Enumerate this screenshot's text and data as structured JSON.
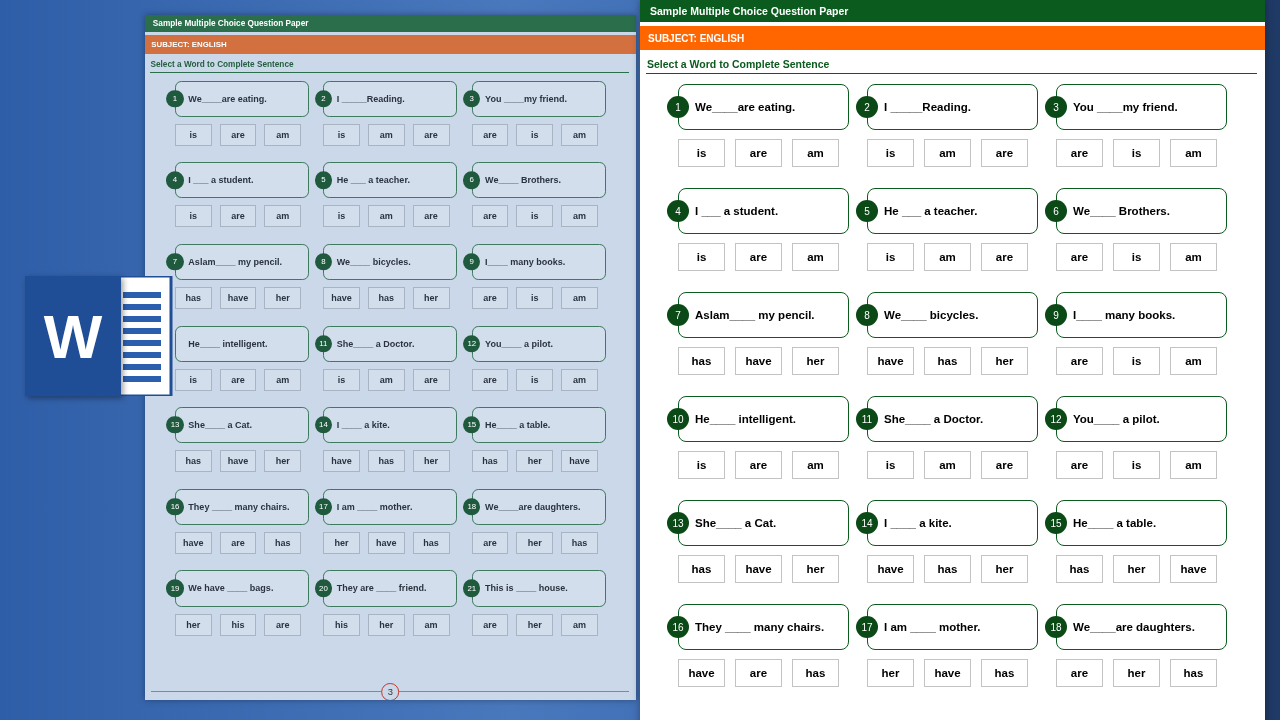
{
  "logo": {
    "letter": "W"
  },
  "back_page": {
    "title": "Sample Multiple Choice Question Paper",
    "subject": "SUBJECT: ENGLISH",
    "instruction": "Select a Word to Complete Sentence",
    "page_number": "3",
    "questions": [
      {
        "number": "1",
        "sentence": "We____are eating.",
        "options": [
          "is",
          "are",
          "am"
        ]
      },
      {
        "number": "2",
        "sentence": "I _____Reading.",
        "options": [
          "is",
          "am",
          "are"
        ]
      },
      {
        "number": "3",
        "sentence": "You ____my friend.",
        "options": [
          "are",
          "is",
          "am"
        ]
      },
      {
        "number": "4",
        "sentence": "I ___ a student.",
        "options": [
          "is",
          "are",
          "am"
        ]
      },
      {
        "number": "5",
        "sentence": "He ___ a teacher.",
        "options": [
          "is",
          "am",
          "are"
        ]
      },
      {
        "number": "6",
        "sentence": "We____ Brothers.",
        "options": [
          "are",
          "is",
          "am"
        ]
      },
      {
        "number": "7",
        "sentence": "Aslam____ my pencil.",
        "options": [
          "has",
          "have",
          "her"
        ]
      },
      {
        "number": "8",
        "sentence": "We____ bicycles.",
        "options": [
          "have",
          "has",
          "her"
        ]
      },
      {
        "number": "9",
        "sentence": "I____ many books.",
        "options": [
          "are",
          "is",
          "am"
        ]
      },
      {
        "sentence": "He____ intelligent.",
        "options": [
          "is",
          "are",
          "am"
        ]
      },
      {
        "number": "11",
        "sentence": "She____ a Doctor.",
        "options": [
          "is",
          "am",
          "are"
        ]
      },
      {
        "number": "12",
        "sentence": "You____ a pilot.",
        "options": [
          "are",
          "is",
          "am"
        ]
      },
      {
        "number": "13",
        "sentence": "She____ a Cat.",
        "options": [
          "has",
          "have",
          "her"
        ]
      },
      {
        "number": "14",
        "sentence": "I ____ a kite.",
        "options": [
          "have",
          "has",
          "her"
        ]
      },
      {
        "number": "15",
        "sentence": "He____ a table.",
        "options": [
          "has",
          "her",
          "have"
        ]
      },
      {
        "number": "16",
        "sentence": "They ____ many chairs.",
        "options": [
          "have",
          "are",
          "has"
        ]
      },
      {
        "number": "17",
        "sentence": "I am ____ mother.",
        "options": [
          "her",
          "have",
          "has"
        ]
      },
      {
        "number": "18",
        "sentence": "We____are daughters.",
        "options": [
          "are",
          "her",
          "has"
        ]
      },
      {
        "number": "19",
        "sentence": "We have ____ bags.",
        "options": [
          "her",
          "his",
          "are"
        ]
      },
      {
        "number": "20",
        "sentence": "They are ____ friend.",
        "options": [
          "his",
          "her",
          "am"
        ]
      },
      {
        "number": "21",
        "sentence": "This is ____ house.",
        "options": [
          "are",
          "her",
          "am"
        ]
      }
    ]
  },
  "front_page": {
    "title": "Sample Multiple Choice Question Paper",
    "subject": "SUBJECT: ENGLISH",
    "instruction": "Select a Word to Complete Sentence",
    "questions": [
      {
        "number": "1",
        "sentence": "We____are eating.",
        "options": [
          "is",
          "are",
          "am"
        ]
      },
      {
        "number": "2",
        "sentence": "I _____Reading.",
        "options": [
          "is",
          "am",
          "are"
        ]
      },
      {
        "number": "3",
        "sentence": "You ____my friend.",
        "options": [
          "are",
          "is",
          "am"
        ]
      },
      {
        "number": "4",
        "sentence": "I ___ a student.",
        "options": [
          "is",
          "are",
          "am"
        ]
      },
      {
        "number": "5",
        "sentence": "He ___ a teacher.",
        "options": [
          "is",
          "am",
          "are"
        ]
      },
      {
        "number": "6",
        "sentence": "We____ Brothers.",
        "options": [
          "are",
          "is",
          "am"
        ]
      },
      {
        "number": "7",
        "sentence": "Aslam____ my pencil.",
        "options": [
          "has",
          "have",
          "her"
        ]
      },
      {
        "number": "8",
        "sentence": "We____ bicycles.",
        "options": [
          "have",
          "has",
          "her"
        ]
      },
      {
        "number": "9",
        "sentence": "I____ many books.",
        "options": [
          "are",
          "is",
          "am"
        ]
      },
      {
        "number": "10",
        "sentence": "He____ intelligent.",
        "options": [
          "is",
          "are",
          "am"
        ]
      },
      {
        "number": "11",
        "sentence": "She____ a Doctor.",
        "options": [
          "is",
          "am",
          "are"
        ]
      },
      {
        "number": "12",
        "sentence": "You____ a pilot.",
        "options": [
          "are",
          "is",
          "am"
        ]
      },
      {
        "number": "13",
        "sentence": "She____ a Cat.",
        "options": [
          "has",
          "have",
          "her"
        ]
      },
      {
        "number": "14",
        "sentence": "I ____ a kite.",
        "options": [
          "have",
          "has",
          "her"
        ]
      },
      {
        "number": "15",
        "sentence": "He____ a table.",
        "options": [
          "has",
          "her",
          "have"
        ]
      },
      {
        "number": "16",
        "sentence": "They ____ many chairs.",
        "options": [
          "have",
          "are",
          "has"
        ]
      },
      {
        "number": "17",
        "sentence": "I am ____ mother.",
        "options": [
          "her",
          "have",
          "has"
        ]
      },
      {
        "number": "18",
        "sentence": "We____are daughters.",
        "options": [
          "are",
          "her",
          "has"
        ]
      }
    ]
  }
}
